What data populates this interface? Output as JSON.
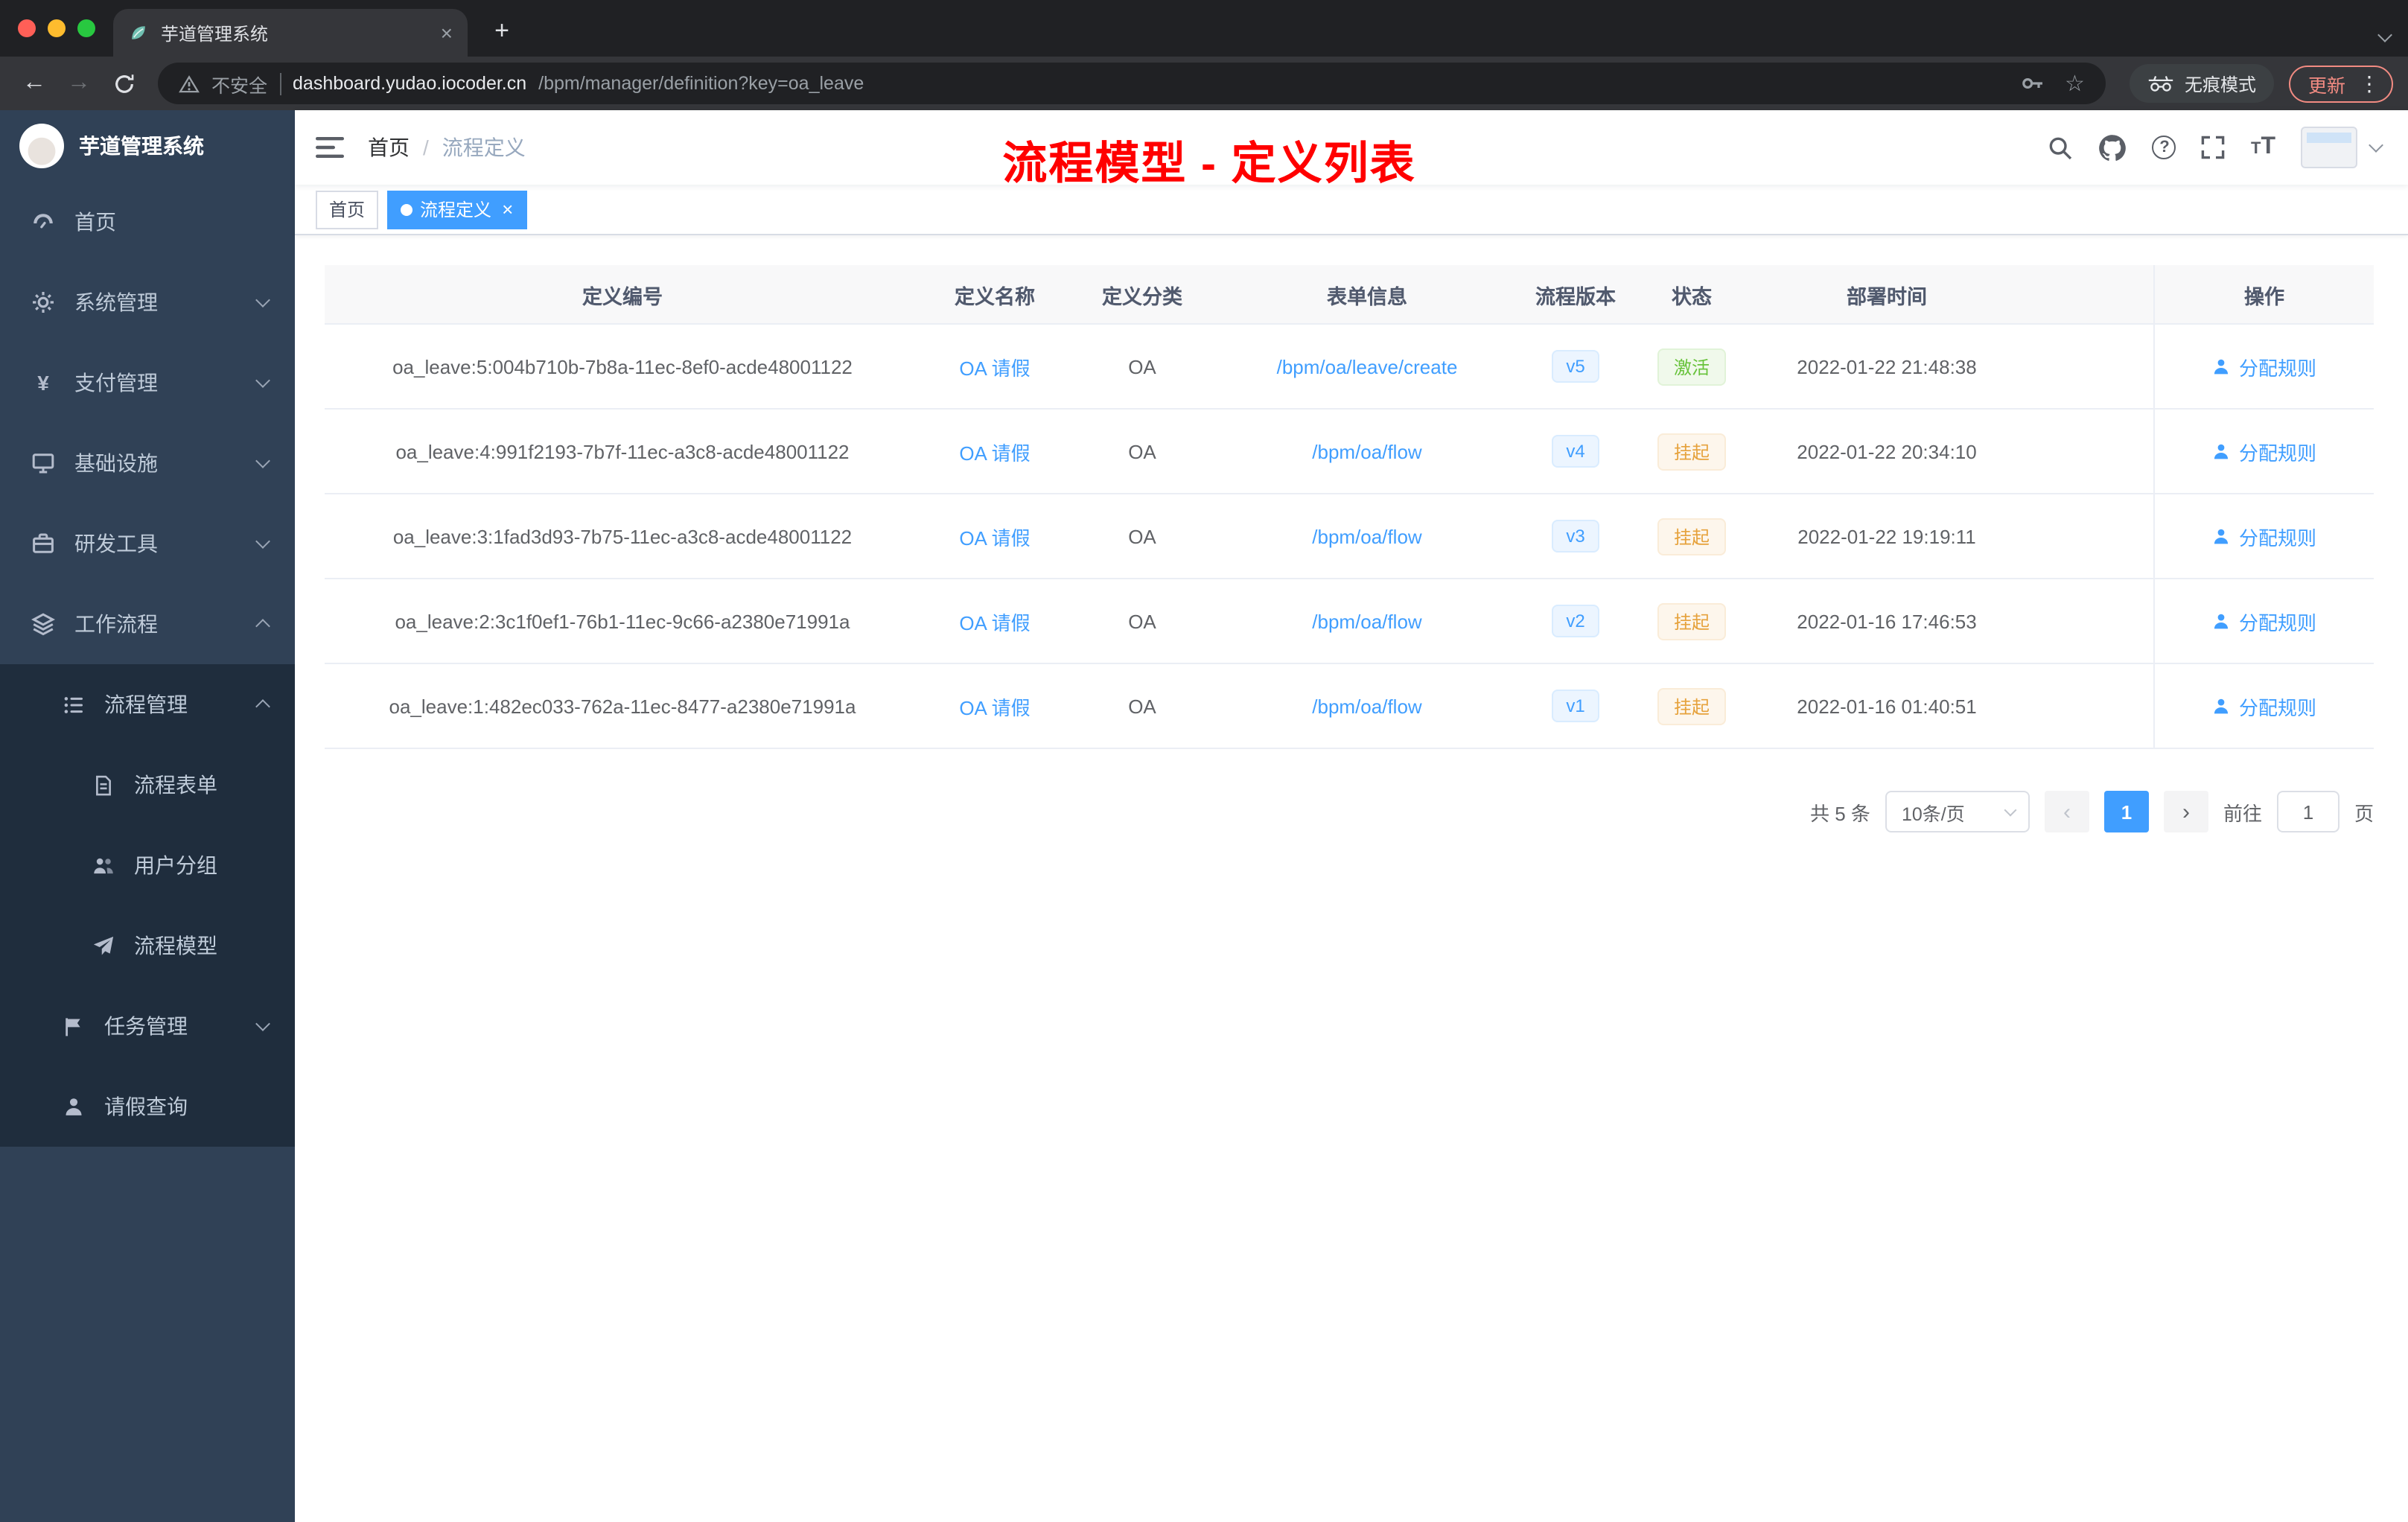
{
  "browser": {
    "tab": {
      "title": "芋道管理系统",
      "close_glyph": "×",
      "new_tab_glyph": "+"
    },
    "toolbar": {
      "back_glyph": "←",
      "forward_glyph": "→",
      "not_secure": "不安全",
      "url_domain": "dashboard.yudao.iocoder.cn",
      "url_path": "/bpm/manager/definition?key=oa_leave",
      "star_glyph": "☆",
      "incognito_label": "无痕模式",
      "update_label": "更新",
      "kebab_glyph": "⋮"
    }
  },
  "sidebar": {
    "logo_title": "芋道管理系统",
    "items": [
      {
        "label": "首页",
        "icon": "dashboard-icon"
      },
      {
        "label": "系统管理",
        "icon": "gear-icon"
      },
      {
        "label": "支付管理",
        "icon": "yen-icon"
      },
      {
        "label": "基础设施",
        "icon": "infrastructure-icon"
      },
      {
        "label": "研发工具",
        "icon": "devtools-icon"
      },
      {
        "label": "工作流程",
        "icon": "workflow-icon"
      },
      {
        "label": "流程管理",
        "icon": "process-manage-icon"
      },
      {
        "label": "流程表单",
        "icon": "form-icon"
      },
      {
        "label": "用户分组",
        "icon": "user-group-icon"
      },
      {
        "label": "流程模型",
        "icon": "model-icon"
      },
      {
        "label": "任务管理",
        "icon": "task-icon"
      },
      {
        "label": "请假查询",
        "icon": "person-icon"
      }
    ],
    "yen_glyph": "¥"
  },
  "navbar": {
    "breadcrumb_home": "首页",
    "breadcrumb_sep": "/",
    "breadcrumb_current": "流程定义"
  },
  "annotation": "流程模型 - 定义列表",
  "tags": {
    "home": "首页",
    "active": "流程定义",
    "close": "×"
  },
  "table": {
    "columns": [
      "定义编号",
      "定义名称",
      "定义分类",
      "表单信息",
      "流程版本",
      "状态",
      "部署时间",
      "操作"
    ],
    "rows": [
      {
        "id": "oa_leave:5:004b710b-7b8a-11ec-8ef0-acde48001122",
        "name": "OA 请假",
        "category": "OA",
        "form": "/bpm/oa/leave/create",
        "version": "v5",
        "status": "激活",
        "status_type": "success",
        "deployed_at": "2022-01-22 21:48:38",
        "action": "分配规则"
      },
      {
        "id": "oa_leave:4:991f2193-7b7f-11ec-a3c8-acde48001122",
        "name": "OA 请假",
        "category": "OA",
        "form": "/bpm/oa/flow",
        "version": "v4",
        "status": "挂起",
        "status_type": "warning",
        "deployed_at": "2022-01-22 20:34:10",
        "action": "分配规则"
      },
      {
        "id": "oa_leave:3:1fad3d93-7b75-11ec-a3c8-acde48001122",
        "name": "OA 请假",
        "category": "OA",
        "form": "/bpm/oa/flow",
        "version": "v3",
        "status": "挂起",
        "status_type": "warning",
        "deployed_at": "2022-01-22 19:19:11",
        "action": "分配规则"
      },
      {
        "id": "oa_leave:2:3c1f0ef1-76b1-11ec-9c66-a2380e71991a",
        "name": "OA 请假",
        "category": "OA",
        "form": "/bpm/oa/flow",
        "version": "v2",
        "status": "挂起",
        "status_type": "warning",
        "deployed_at": "2022-01-16 17:46:53",
        "action": "分配规则"
      },
      {
        "id": "oa_leave:1:482ec033-762a-11ec-8477-a2380e71991a",
        "name": "OA 请假",
        "category": "OA",
        "form": "/bpm/oa/flow",
        "version": "v1",
        "status": "挂起",
        "status_type": "warning",
        "deployed_at": "2022-01-16 01:40:51",
        "action": "分配规则"
      }
    ]
  },
  "pagination": {
    "total": "共 5 条",
    "page_size": "10条/页",
    "prev_glyph": "‹",
    "next_glyph": "›",
    "page": "1",
    "goto_label": "前往",
    "goto_value": "1",
    "unit_label": "页"
  },
  "colors": {
    "accent": "#409eff",
    "success": "#67c23a",
    "warning": "#e6a23c",
    "annotation_red": "#ff0000",
    "sidebar_bg": "#304156",
    "submenu_bg": "#1f2d3d"
  }
}
